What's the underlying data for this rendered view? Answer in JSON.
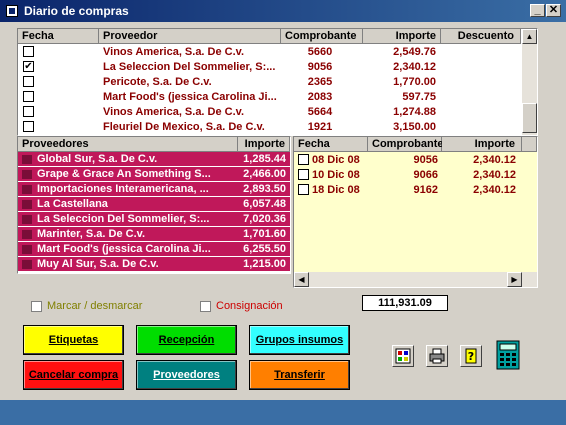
{
  "window": {
    "title": "Diario de compras"
  },
  "purchases": {
    "headers": {
      "fecha": "Fecha",
      "proveedor": "Proveedor",
      "comprobante": "Comprobante",
      "importe": "Importe",
      "descuento": "Descuento"
    },
    "rows": [
      {
        "checked": false,
        "proveedor": "Vinos America, S.a. De C.v.",
        "comprobante": "5660",
        "importe": "2,549.76"
      },
      {
        "checked": true,
        "proveedor": "La Seleccion Del Sommelier, S:...",
        "comprobante": "9056",
        "importe": "2,340.12"
      },
      {
        "checked": false,
        "proveedor": "Pericote, S.a. De C.v.",
        "comprobante": "2365",
        "importe": "1,770.00"
      },
      {
        "checked": false,
        "proveedor": "Mart Food's (jessica Carolina Ji...",
        "comprobante": "2083",
        "importe": "597.75"
      },
      {
        "checked": false,
        "proveedor": "Vinos America, S.a. De C.v.",
        "comprobante": "5664",
        "importe": "1,274.88"
      },
      {
        "checked": false,
        "proveedor": "Fleuriel De Mexico, S.a. De C.v.",
        "comprobante": "1921",
        "importe": "3,150.00"
      }
    ]
  },
  "suppliers": {
    "headers": {
      "proveedores": "Proveedores",
      "importe": "Importe"
    },
    "rows": [
      {
        "name": "Global Sur, S.a. De C.v.",
        "importe": "1,285.44"
      },
      {
        "name": "Grape & Grace An Something S...",
        "importe": "2,466.00"
      },
      {
        "name": "Importaciones Interamericana, ...",
        "importe": "2,893.50"
      },
      {
        "name": "La Castellana",
        "importe": "6,057.48"
      },
      {
        "name": "La Seleccion Del Sommelier, S:...",
        "importe": "7,020.36"
      },
      {
        "name": "Marinter, S.a. De C.v.",
        "importe": "1,701.60"
      },
      {
        "name": "Mart Food's (jessica Carolina Ji...",
        "importe": "6,255.50"
      },
      {
        "name": "Muy Al Sur, S.a. De C.v.",
        "importe": "1,215.00"
      }
    ]
  },
  "details": {
    "headers": {
      "fecha": "Fecha",
      "comprobante": "Comprobante",
      "importe": "Importe"
    },
    "rows": [
      {
        "fecha": "08 Dic 08",
        "comprobante": "9056",
        "importe": "2,340.12"
      },
      {
        "fecha": "10 Dic 08",
        "comprobante": "9066",
        "importe": "2,340.12"
      },
      {
        "fecha": "18 Dic 08",
        "comprobante": "9162",
        "importe": "2,340.12"
      }
    ]
  },
  "options": {
    "marcar": "Marcar / desmarcar",
    "consignacion": "Consignación"
  },
  "total": "111,931.09",
  "buttons": {
    "etiquetas": "Etiquetas",
    "recepcion": "Recepción",
    "grupos": "Grupos insumos",
    "cancelar": "Cancelar compra",
    "proveedores": "Proveedores",
    "transferir": "Transferir"
  },
  "colors": {
    "titlebar": "#0a246a",
    "supplier_row": "#c0185a",
    "details_bg": "#ffffcc",
    "btn_yellow": "#ffff00",
    "btn_green": "#00dd00",
    "btn_cyan": "#33ffff",
    "btn_red": "#ff1010",
    "btn_teal": "#008080",
    "btn_orange": "#ff7f00"
  }
}
